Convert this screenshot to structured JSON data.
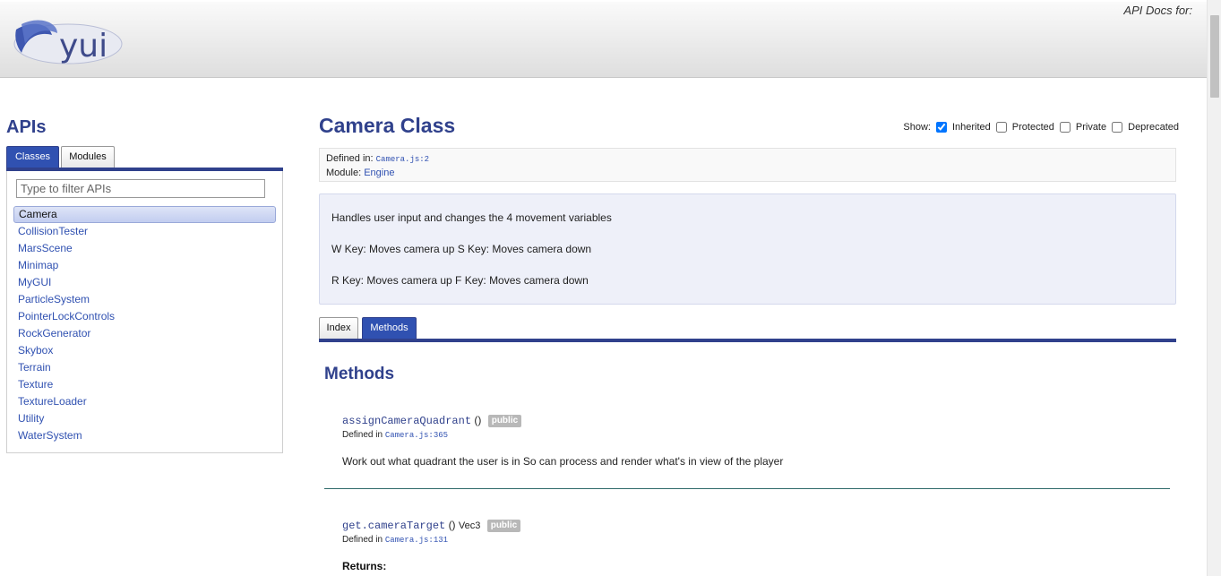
{
  "header": {
    "logo_text": "yui",
    "api_docs_label": "API Docs for:"
  },
  "sidebar": {
    "title": "APIs",
    "tabs": [
      {
        "label": "Classes",
        "active": true
      },
      {
        "label": "Modules",
        "active": false
      }
    ],
    "filter": {
      "placeholder": "Type to filter APIs",
      "value": ""
    },
    "classes": [
      {
        "label": "Camera",
        "selected": true
      },
      {
        "label": "CollisionTester"
      },
      {
        "label": "MarsScene"
      },
      {
        "label": "Minimap"
      },
      {
        "label": "MyGUI"
      },
      {
        "label": "ParticleSystem"
      },
      {
        "label": "PointerLockControls"
      },
      {
        "label": "RockGenerator"
      },
      {
        "label": "Skybox"
      },
      {
        "label": "Terrain"
      },
      {
        "label": "Texture"
      },
      {
        "label": "TextureLoader"
      },
      {
        "label": "Utility"
      },
      {
        "label": "WaterSystem"
      }
    ]
  },
  "main": {
    "title": "Camera Class",
    "show": {
      "label": "Show:",
      "options": [
        {
          "label": "Inherited",
          "checked": true
        },
        {
          "label": "Protected",
          "checked": false
        },
        {
          "label": "Private",
          "checked": false
        },
        {
          "label": "Deprecated",
          "checked": false
        }
      ]
    },
    "defined_in": {
      "label": "Defined in:",
      "file": "Camera.js:2"
    },
    "module": {
      "label": "Module:",
      "name": "Engine"
    },
    "description": [
      "Handles user input and changes the 4 movement variables",
      "W Key: Moves camera up S Key: Moves camera down",
      "R Key: Moves camera up F Key: Moves camera down"
    ],
    "tabs": [
      {
        "label": "Index",
        "active": false
      },
      {
        "label": "Methods",
        "active": true
      }
    ],
    "methods_heading": "Methods",
    "methods": [
      {
        "name": "assignCameraQuadrant",
        "params": "()",
        "returns_type": "",
        "badge": "public",
        "defined_label": "Defined in",
        "defined_file": "Camera.js:365",
        "description": "Work out what quadrant the user is in So can process and render what's in view of the player"
      },
      {
        "name": "get.cameraTarget",
        "params": "()",
        "returns_type": "Vec3",
        "badge": "public",
        "defined_label": "Defined in",
        "defined_file": "Camera.js:131",
        "returns_label": "Returns:"
      }
    ]
  },
  "colors": {
    "brand_blue": "#30418c",
    "link_blue": "#3051b1",
    "description_bg": "#eef0f9"
  }
}
